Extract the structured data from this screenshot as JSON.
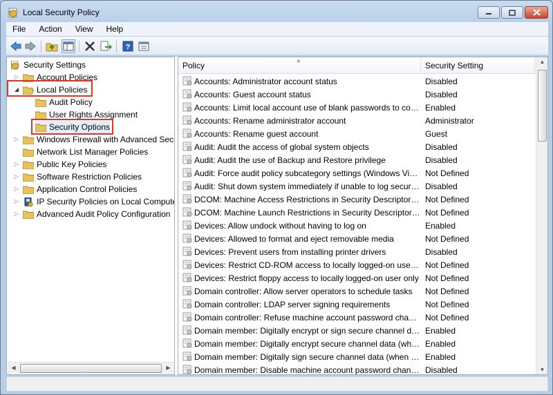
{
  "window": {
    "title": "Local Security Policy"
  },
  "menu": [
    "File",
    "Action",
    "View",
    "Help"
  ],
  "toolbar": {
    "buttons": [
      "back-icon",
      "forward-icon",
      "up-folder-icon",
      "show-hide-tree-icon",
      "delete-icon",
      "export-list-icon",
      "help-icon",
      "properties-icon"
    ]
  },
  "tree": {
    "root": "Security Settings",
    "items": [
      "Account Policies",
      "Local Policies",
      "Audit Policy",
      "User Rights Assignment",
      "Security Options",
      "Windows Firewall with Advanced Security",
      "Network List Manager Policies",
      "Public Key Policies",
      "Software Restriction Policies",
      "Application Control Policies",
      "IP Security Policies on Local Computer",
      "Advanced Audit Policy Configuration"
    ]
  },
  "list": {
    "columns": [
      "Policy",
      "Security Setting"
    ],
    "rows": [
      [
        "Accounts: Administrator account status",
        "Disabled"
      ],
      [
        "Accounts: Guest account status",
        "Disabled"
      ],
      [
        "Accounts: Limit local account use of blank passwords to console logon only",
        "Enabled"
      ],
      [
        "Accounts: Rename administrator account",
        "Administrator"
      ],
      [
        "Accounts: Rename guest account",
        "Guest"
      ],
      [
        "Audit: Audit the access of global system objects",
        "Disabled"
      ],
      [
        "Audit: Audit the use of Backup and Restore privilege",
        "Disabled"
      ],
      [
        "Audit: Force audit policy subcategory settings (Windows Vista or later)",
        "Not Defined"
      ],
      [
        "Audit: Shut down system immediately if unable to log security audits",
        "Disabled"
      ],
      [
        "DCOM: Machine Access Restrictions in Security Descriptor Definition Language",
        "Not Defined"
      ],
      [
        "DCOM: Machine Launch Restrictions in Security Descriptor Definition Language",
        "Not Defined"
      ],
      [
        "Devices: Allow undock without having to log on",
        "Enabled"
      ],
      [
        "Devices: Allowed to format and eject removable media",
        "Not Defined"
      ],
      [
        "Devices: Prevent users from installing printer drivers",
        "Disabled"
      ],
      [
        "Devices: Restrict CD-ROM access to locally logged-on user only",
        "Not Defined"
      ],
      [
        "Devices: Restrict floppy access to locally logged-on user only",
        "Not Defined"
      ],
      [
        "Domain controller: Allow server operators to schedule tasks",
        "Not Defined"
      ],
      [
        "Domain controller: LDAP server signing requirements",
        "Not Defined"
      ],
      [
        "Domain controller: Refuse machine account password changes",
        "Not Defined"
      ],
      [
        "Domain member: Digitally encrypt or sign secure channel data (always)",
        "Enabled"
      ],
      [
        "Domain member: Digitally encrypt secure channel data (when possible)",
        "Enabled"
      ],
      [
        "Domain member: Digitally sign secure channel data (when possible)",
        "Enabled"
      ],
      [
        "Domain member: Disable machine account password changes",
        "Disabled"
      ]
    ]
  },
  "colors": {
    "highlight": "#e0342b",
    "window_frame": "#b9d1ea",
    "folder": "#e8c25a"
  }
}
